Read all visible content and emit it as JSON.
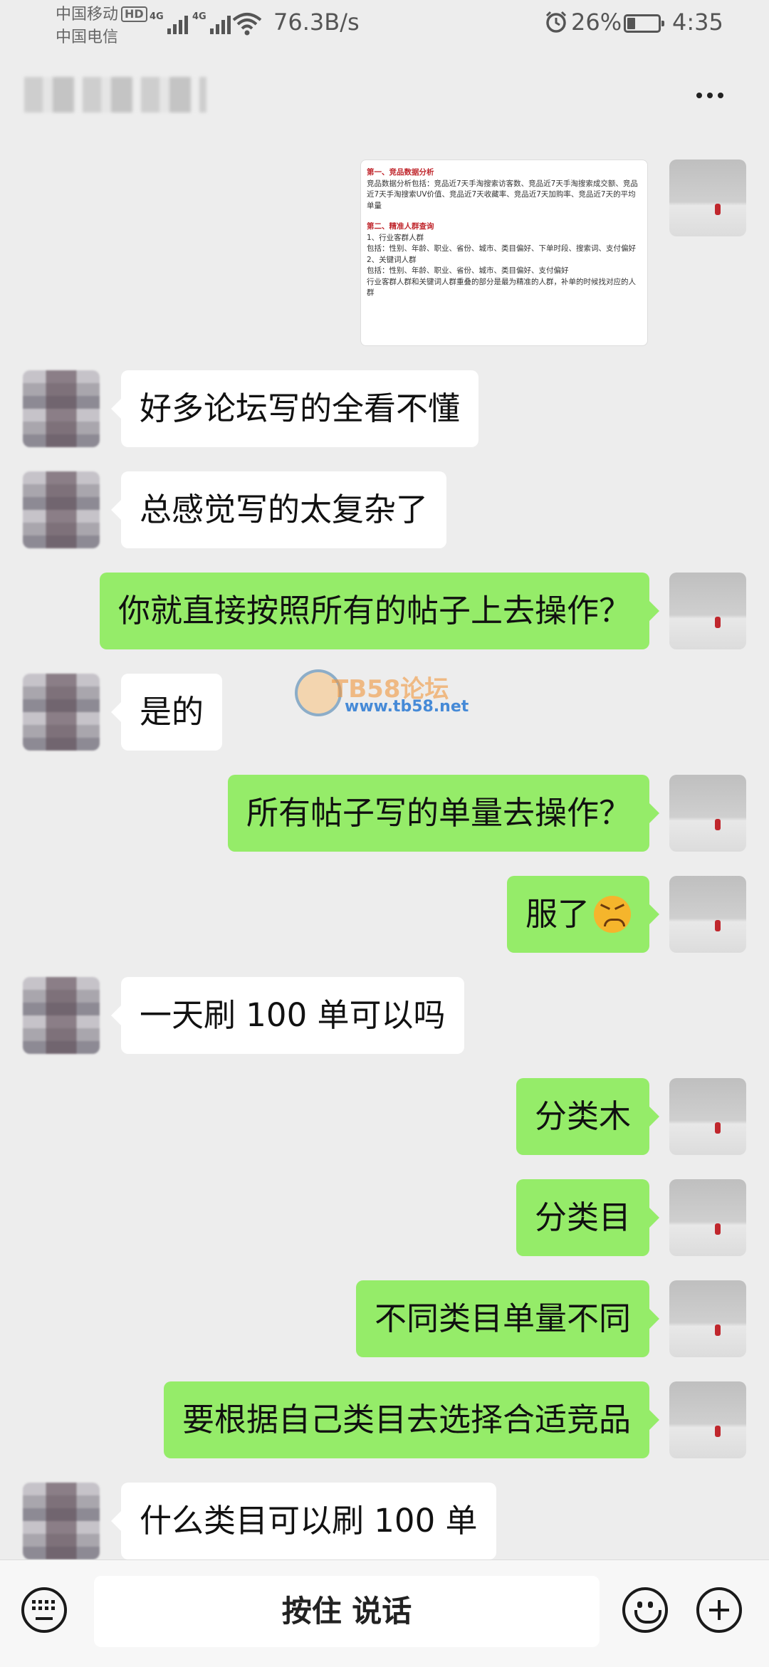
{
  "status_bar": {
    "carrier_1": "中国移动",
    "carrier_1_badge": "HD",
    "carrier_2": "中国电信",
    "network_1": "4G",
    "network_2": "4G",
    "net_speed": "76.3B/s",
    "battery": "26%",
    "battery_level": 0.26,
    "time": "4:35"
  },
  "header": {
    "title_blurred": true,
    "more_icon": "more-dots-icon"
  },
  "doc_image": {
    "section1_title": "第一、竞品数据分析",
    "section1_body": "竞品数据分析包括：竞品近7天手淘搜索访客数、竞品近7天手淘搜索成交额、竞品近7天手淘搜索UV价值、竞品近7天收藏率、竞品近7天加购率、竞品近7天的平均单量",
    "section2_title": "第二、精准人群查询",
    "line1": "1、行业客群人群",
    "line2": "包括：性别、年龄、职业、省份、城市、类目偏好、下单时段、搜索词、支付偏好",
    "line3": "2、关键词人群",
    "line4": "包括：性别、年龄、职业、省份、城市、类目偏好、支付偏好",
    "line5": "行业客群人群和关键词人群重叠的部分是最为精准的人群，补单的时候找对应的人群"
  },
  "messages": [
    {
      "side": "peer",
      "text": "好多论坛写的全看不懂"
    },
    {
      "side": "peer",
      "text": "总感觉写的太复杂了"
    },
    {
      "side": "self",
      "text": "你就直接按照所有的帖子上去操作？"
    },
    {
      "side": "peer",
      "text": "是的"
    },
    {
      "side": "self",
      "text": "所有帖子写的单量去操作？"
    },
    {
      "side": "self",
      "text": "服了",
      "emoji": "persevering-face-icon"
    },
    {
      "side": "peer",
      "text": "一天刷 100 单可以吗"
    },
    {
      "side": "self",
      "text": "分类木"
    },
    {
      "side": "self",
      "text": "分类目"
    },
    {
      "side": "self",
      "text": "不同类目单量不同"
    },
    {
      "side": "self",
      "text": "要根据自己类目去选择合适竞品"
    },
    {
      "side": "peer",
      "text": "什么类目可以刷 100 单"
    }
  ],
  "watermark": {
    "brand": "TB58论坛",
    "url": "www.tb58.net"
  },
  "input_bar": {
    "hold_to_talk": "按住 说话",
    "left_icon": "keyboard-icon",
    "emoji_icon": "emoji-icon",
    "plus_icon": "plus-icon"
  },
  "colors": {
    "background": "#ededed",
    "self_bubble": "#95ec69",
    "peer_bubble": "#ffffff"
  }
}
